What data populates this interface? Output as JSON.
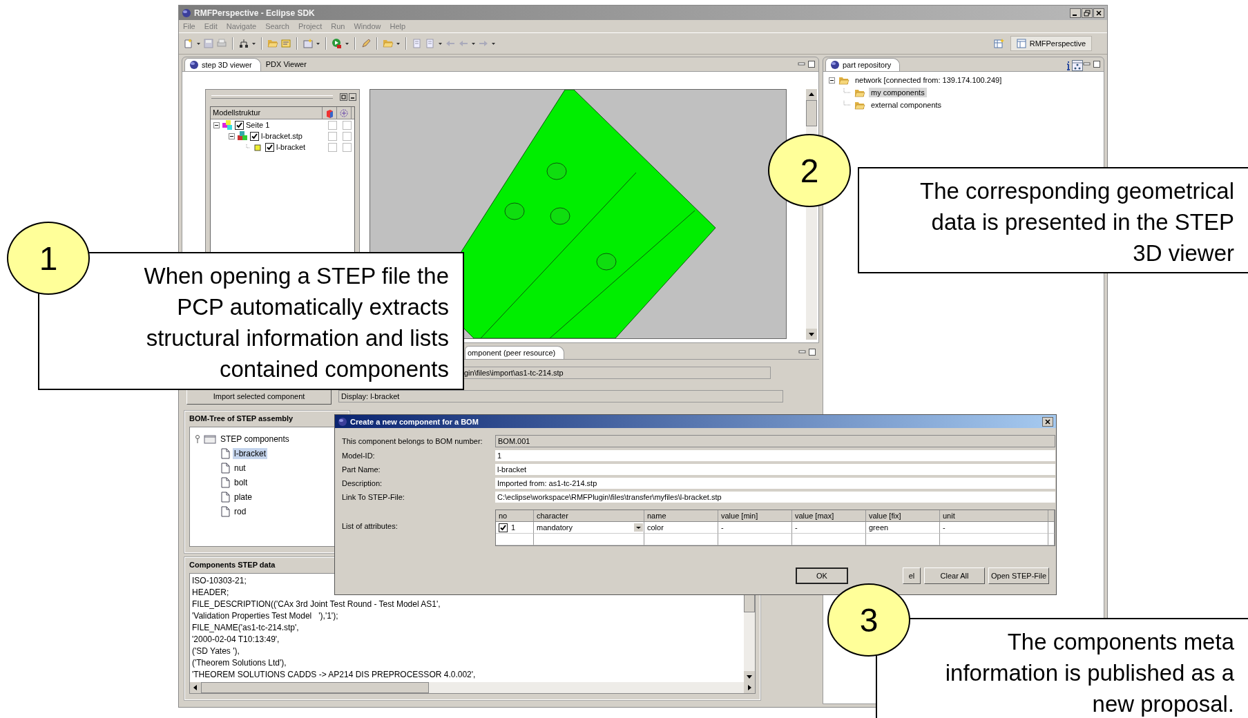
{
  "window": {
    "title": "RMFPerspective - Eclipse SDK"
  },
  "menu": [
    "File",
    "Edit",
    "Navigate",
    "Search",
    "Project",
    "Run",
    "Window",
    "Help"
  ],
  "perspective_button": "RMFPerspective",
  "editor": {
    "tabs": [
      {
        "label": "step 3D viewer",
        "selected": true
      },
      {
        "label": "PDX Viewer",
        "selected": false
      }
    ],
    "model_tree": {
      "header": "Modellstruktur",
      "items": [
        {
          "label": "Seite 1",
          "checked": true,
          "expanded": true,
          "flags": [
            false,
            false
          ],
          "children": [
            {
              "label": "l-bracket.stp",
              "checked": true,
              "expanded": true,
              "flags": [
                false,
                false
              ],
              "children": [
                {
                  "label": "l-bracket",
                  "checked": true,
                  "flags": [
                    false,
                    false
                  ]
                }
              ]
            }
          ]
        }
      ]
    }
  },
  "component_panel": {
    "tab": "omponent (peer resource)",
    "path_value": "gin\\files\\import\\as1-tc-214.stp",
    "import_button": "Import selected component",
    "display_value": "Display: l-bracket",
    "bom_tree": {
      "title": "BOM-Tree of STEP assembly",
      "root": {
        "label": "STEP components",
        "expanded": true,
        "children": [
          {
            "label": "l-bracket",
            "selected": true
          },
          {
            "label": "nut",
            "selected": false
          },
          {
            "label": "bolt",
            "selected": false
          },
          {
            "label": "plate",
            "selected": false
          },
          {
            "label": "rod",
            "selected": false
          }
        ]
      }
    },
    "step_data": {
      "title": "Components STEP data",
      "lines": [
        "ISO-10303-21;",
        "HEADER;",
        "FILE_DESCRIPTION(('CAx 3rd Joint Test Round - Test Model AS1',",
        "'Validation Properties Test Model   '),'1');",
        "FILE_NAME('as1-tc-214.stp',",
        "'2000-02-04 T10:13:49',",
        "('SD Yates '),",
        "('Theorem Solutions Ltd'),",
        "'THEOREM SOLUTIONS CADDS -> AP214 DIS PREPROCESSOR 4.0.002',"
      ]
    }
  },
  "part_repository": {
    "tab": "part repository",
    "tree": [
      {
        "label": "network [connected from: 139.174.100.249]",
        "expanded": true,
        "selected": false,
        "children": [
          {
            "label": "my components",
            "selected": true
          },
          {
            "label": "external components",
            "selected": false
          }
        ]
      }
    ]
  },
  "dialog": {
    "title": "Create a new component for a BOM",
    "fields": [
      {
        "label": "This component belongs to BOM number:",
        "value": "BOM.001",
        "disabled": true
      },
      {
        "label": "Model-ID:",
        "value": "1",
        "disabled": false
      },
      {
        "label": "Part Name:",
        "value": "l-bracket",
        "disabled": false
      },
      {
        "label": "Description:",
        "value": "Imported from: as1-tc-214.stp",
        "disabled": false
      },
      {
        "label": "Link To STEP-File:",
        "value": "C:\\eclipse\\workspace\\RMFPlugin\\files\\transfer\\myfiles\\l-bracket.stp",
        "disabled": false
      }
    ],
    "attributes_label": "List of attributes:",
    "columns": [
      "no",
      "character",
      "name",
      "value [min]",
      "value [max]",
      "value [fix]",
      "unit"
    ],
    "rows": [
      {
        "checked": true,
        "cells": [
          "1",
          "mandatory",
          "color",
          "-",
          "-",
          "green",
          "-"
        ]
      }
    ],
    "buttons": [
      "OK",
      "el",
      "Clear All",
      "Open STEP-File"
    ]
  },
  "callouts": [
    {
      "number": "1",
      "text": "When opening a STEP file the\nPCP automatically extracts\nstructural information and lists\ncontained components"
    },
    {
      "number": "2",
      "text": "The corresponding geometrical\ndata is presented in the STEP\n3D viewer"
    },
    {
      "number": "3",
      "text": "The components meta\ninformation is published as a\nnew proposal."
    }
  ]
}
